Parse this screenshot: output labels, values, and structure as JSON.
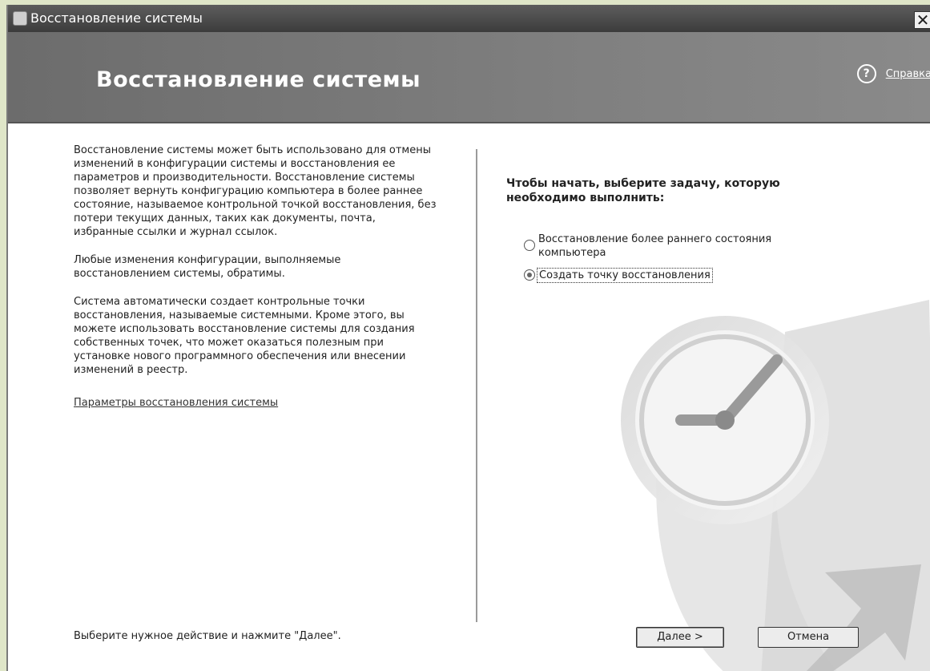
{
  "window": {
    "title": "Восстановление системы",
    "close_glyph": "✕"
  },
  "banner": {
    "heading": "Восстановление системы",
    "help_icon": "?",
    "help_label": "Справка"
  },
  "left": {
    "paragraph1": "Восстановление системы может быть использовано для отмены изменений в конфигурации системы и восстановления ее параметров и производительности. Восстановление системы позволяет вернуть конфигурацию компьютера в более раннее состояние, называемое контрольной точкой восстановления, без потери текущих данных, таких как документы, почта, избранные ссылки и журнал ссылок.",
    "paragraph2": "Любые изменения конфигурации, выполняемые восстановлением системы, обратимы.",
    "paragraph3": "Система автоматически создает контрольные точки восстановления, называемые системными. Кроме этого, вы можете использовать восстановление системы для создания собственных точек, что может оказаться полезным при установке нового программного обеспечения или внесении изменений в реестр.",
    "settings_link": "Параметры восстановления системы",
    "footer": "Выберите нужное действие и нажмите \"Далее\"."
  },
  "right": {
    "prompt": "Чтобы начать, выберите задачу, которую необходимо выполнить:",
    "options": [
      {
        "label": "Восстановление более раннего состояния компьютера",
        "selected": false
      },
      {
        "label": "Создать точку восстановления",
        "selected": true
      }
    ]
  },
  "buttons": {
    "next": "Далее >",
    "cancel": "Отмена"
  },
  "icons": {
    "app": "system-restore-icon",
    "help": "help-icon",
    "close": "close-icon",
    "art": "clock-restore-icon"
  }
}
